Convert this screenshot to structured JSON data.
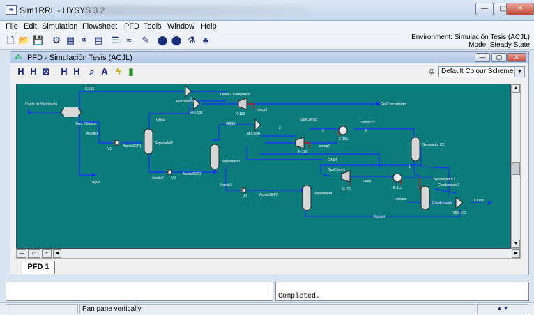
{
  "window": {
    "title": "Sim1RRL - HYSYS 3.2"
  },
  "menu": [
    "File",
    "Edit",
    "Simulation",
    "Flowsheet",
    "PFD",
    "Tools",
    "Window",
    "Help"
  ],
  "environment": {
    "line1": "Environment: Simulación Tesis (ACJL)",
    "line2": "Mode: Steady State"
  },
  "pfd": {
    "title": "PFD - Simulación Tesis (ACJL)",
    "color_scheme": "Default Colour Scheme",
    "tab": "PFD 1"
  },
  "streams": {
    "gas1": "GAS1",
    "crudo": "Crudo de Yacimiento",
    "trifasico": "Sep. Trifasico",
    "aceite1": "Aceite1",
    "agua": "Agua",
    "v1": "V1",
    "aceitesep1": "AceiteSEP1",
    "separador2": "Separador2",
    "gas2": "GAS2",
    "aceite2": "Aceite2",
    "v2": "V2",
    "aceitesep2": "AceiteSEP2",
    "mezcladora": "Mezcladora",
    "mix101": "MIX-101",
    "num6": "6",
    "linea": "Linea a Compresor",
    "k102": "K-102",
    "comp3": "comp3",
    "gascomprimido": "GasComprimido",
    "gas3": "GAS3",
    "separador3": "Separador3",
    "mix100": "MIX-100",
    "num2": "2",
    "gascomp2": "GasComp2",
    "k100": "K-100",
    "comp2": "comp2",
    "num3": "3",
    "e101": "E-101",
    "compcc2": "compcc2",
    "num5": "5",
    "separadorc2": "Separador C2",
    "aceite3": "Aceite3",
    "v3": "V3",
    "aceitesep3": "AceiteSEP3",
    "separador4": "Separador4",
    "gas4": "GAS4",
    "gascomp1": "GasComp1",
    "k101": "K-101",
    "comp": "comp",
    "e1cc": "E-1cc",
    "compcc": "compcc",
    "num1": "1",
    "separadorc1": "Separador C1",
    "condensado2": "Condensado2",
    "condensado": "Condensado",
    "mix102": "MIX-102",
    "crudo2": "Crudo",
    "aceite4": "Aceite4"
  },
  "messages": {
    "completed": "Completed."
  },
  "status": {
    "text": "Pan pane vertically"
  },
  "colors": {
    "canvas": "#0c7b7b",
    "stream": "#1a2cff",
    "energy": "#d01010"
  }
}
